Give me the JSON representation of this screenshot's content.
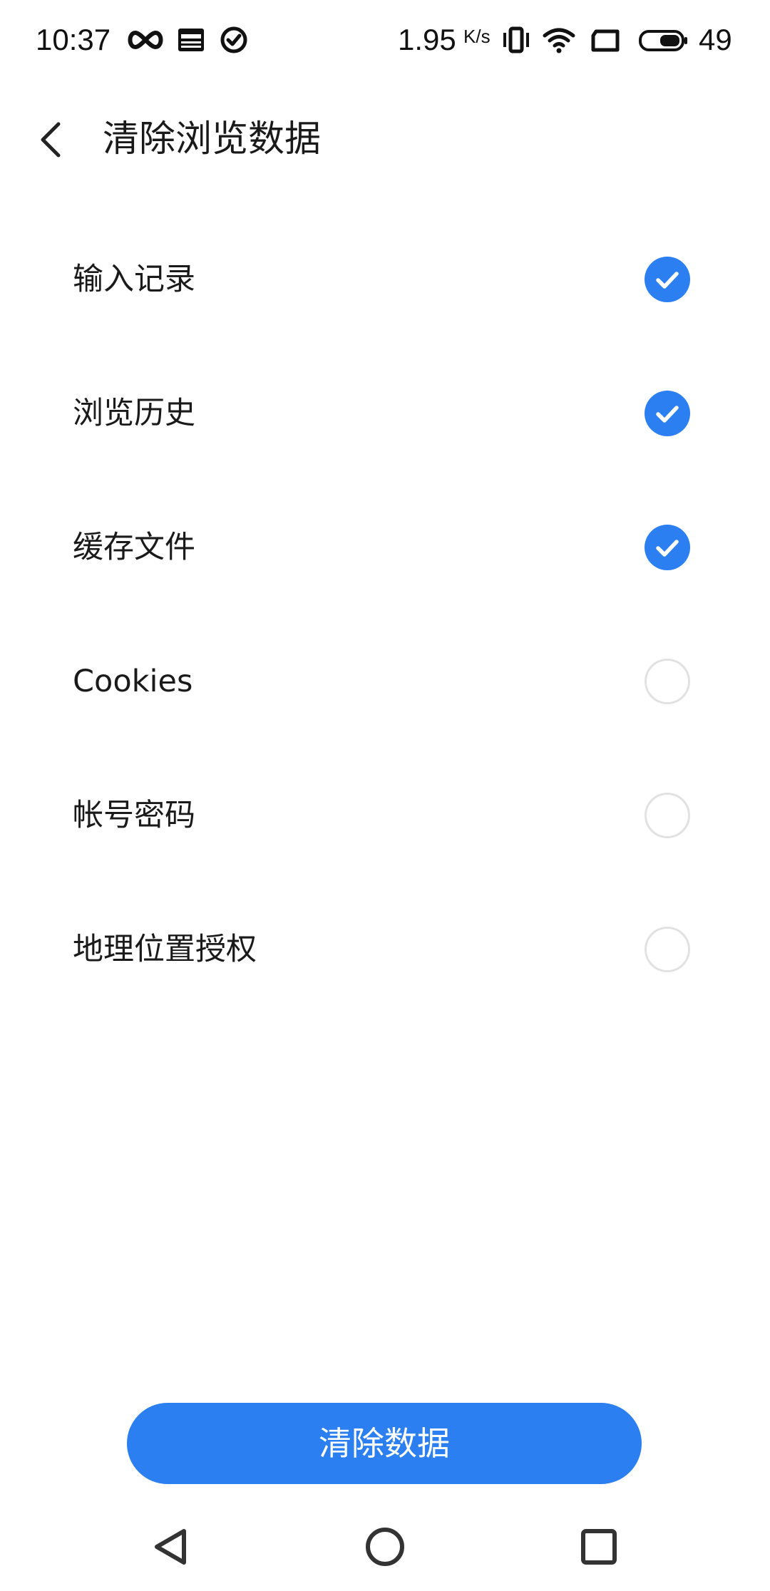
{
  "status_bar": {
    "time": "10:37",
    "net_speed": "1.95",
    "net_speed_unit": "K/s",
    "battery": "49",
    "icons": [
      "infinity-icon",
      "news-icon",
      "check-circle-icon",
      "vibrate-icon",
      "wifi-icon",
      "screen-rotate-icon",
      "battery-icon"
    ]
  },
  "header": {
    "title": "清除浏览数据",
    "back_icon": "chevron-left-icon"
  },
  "options": [
    {
      "label": "输入记录",
      "checked": true
    },
    {
      "label": "浏览历史",
      "checked": true
    },
    {
      "label": "缓存文件",
      "checked": true
    },
    {
      "label": "Cookies",
      "checked": false
    },
    {
      "label": "帐号密码",
      "checked": false
    },
    {
      "label": "地理位置授权",
      "checked": false
    }
  ],
  "actions": {
    "clear_label": "清除数据"
  },
  "nav_bar": {
    "icons": [
      "back-triangle-icon",
      "home-circle-icon",
      "recents-square-icon"
    ]
  },
  "colors": {
    "accent": "#2b7ff0",
    "unchecked_border": "#e2e2e2",
    "text": "#1a1a1a",
    "background": "#ffffff"
  }
}
